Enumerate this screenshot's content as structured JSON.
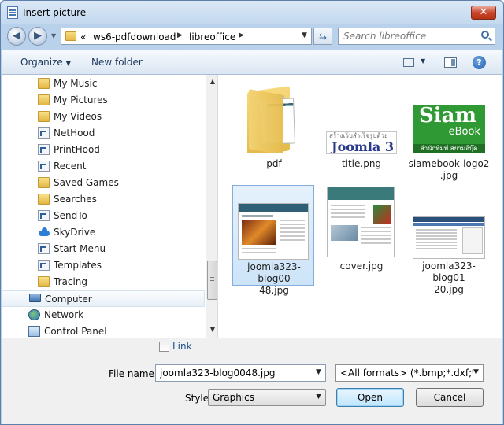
{
  "window": {
    "title": "Insert picture",
    "close_glyph": "✕"
  },
  "address": {
    "path": [
      "ws6-pdfdownload",
      "libreoffice"
    ],
    "overflow_glyph": "«",
    "search_placeholder": "Search libreoffice"
  },
  "toolbar": {
    "organize_label": "Organize",
    "new_folder_label": "New folder",
    "help_glyph": "?"
  },
  "nav": {
    "items": [
      {
        "label": "My Music",
        "icon": "folder-icon"
      },
      {
        "label": "My Pictures",
        "icon": "folder-icon"
      },
      {
        "label": "My Videos",
        "icon": "folder-icon"
      },
      {
        "label": "NetHood",
        "icon": "shortcut-icon"
      },
      {
        "label": "PrintHood",
        "icon": "shortcut-icon"
      },
      {
        "label": "Recent",
        "icon": "shortcut-icon"
      },
      {
        "label": "Saved Games",
        "icon": "folder-icon"
      },
      {
        "label": "Searches",
        "icon": "folder-icon"
      },
      {
        "label": "SendTo",
        "icon": "shortcut-icon"
      },
      {
        "label": "SkyDrive",
        "icon": "skydrive-icon"
      },
      {
        "label": "Start Menu",
        "icon": "shortcut-icon"
      },
      {
        "label": "Templates",
        "icon": "shortcut-icon"
      },
      {
        "label": "Tracing",
        "icon": "folder-icon"
      },
      {
        "label": "Computer",
        "icon": "computer-icon",
        "selected": true
      },
      {
        "label": "Network",
        "icon": "network-icon"
      },
      {
        "label": "Control Panel",
        "icon": "control-panel-icon"
      }
    ]
  },
  "files": {
    "items": [
      {
        "label": "pdf"
      },
      {
        "label": "title.png",
        "thumb_top": "สร้างเว็บสำเร็จรูปด้วย",
        "thumb_main": "Joomla 3"
      },
      {
        "label": "siamebook-logo2.jpg",
        "thumb_main": "Siam",
        "thumb_sub": "eBook",
        "thumb_foot": "สำนักพิมพ์ สยามอีบุ๊ค"
      },
      {
        "label": "joomla323-blog0048.jpg",
        "selected": true
      },
      {
        "label": "cover.jpg"
      },
      {
        "label": "joomla323-blog0120.jpg"
      }
    ]
  },
  "bottom": {
    "link_label": "Link",
    "link_checked": false,
    "file_name_label": "File name:",
    "file_name_value": "joomla323-blog0048.jpg",
    "filter_value": "<All formats> (*.bmp;*.dxf;*.en",
    "style_label": "Style",
    "style_value": "Graphics",
    "open_label": "Open",
    "cancel_label": "Cancel"
  },
  "colors": {
    "accent": "#3d6ea8",
    "selection": "#cde4f8",
    "frame": "#b9d1ea"
  }
}
